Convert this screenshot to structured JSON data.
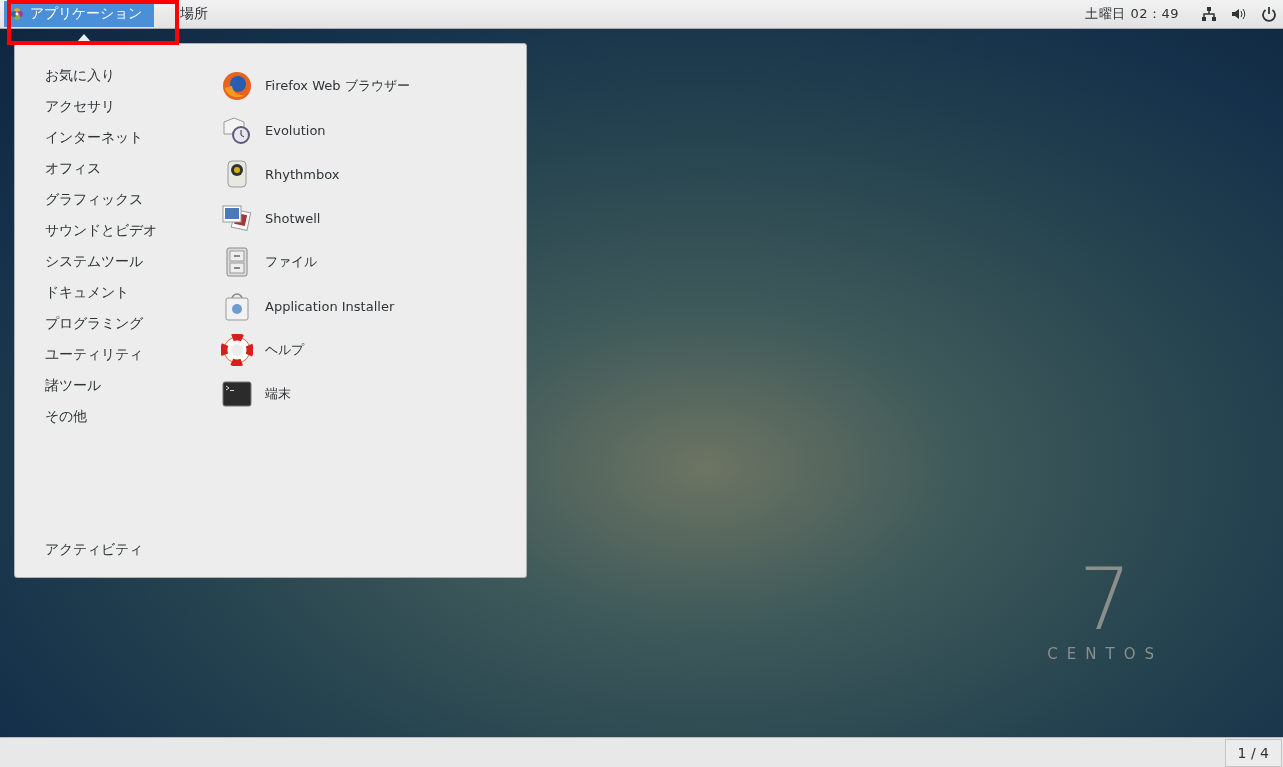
{
  "top_bar": {
    "menus": [
      {
        "label": "アプリケーション",
        "selected": true
      },
      {
        "label": "場所",
        "selected": false
      }
    ],
    "clock": "土曜日 02：49"
  },
  "applications_menu": {
    "categories": [
      {
        "label": "お気に入り"
      },
      {
        "label": "アクセサリ"
      },
      {
        "label": "インターネット"
      },
      {
        "label": "オフィス"
      },
      {
        "label": "グラフィックス"
      },
      {
        "label": "サウンドとビデオ"
      },
      {
        "label": "システムツール"
      },
      {
        "label": "ドキュメント"
      },
      {
        "label": "プログラミング"
      },
      {
        "label": "ユーティリティ"
      },
      {
        "label": "諸ツール"
      },
      {
        "label": "その他"
      }
    ],
    "activities": "アクティビティ",
    "apps": [
      {
        "kind": "firefox",
        "label": "Firefox Web ブラウザー"
      },
      {
        "kind": "evolution",
        "label": "Evolution"
      },
      {
        "kind": "rhythmbox",
        "label": "Rhythmbox"
      },
      {
        "kind": "shotwell",
        "label": "Shotwell"
      },
      {
        "kind": "files",
        "label": "ファイル"
      },
      {
        "kind": "installer",
        "label": "Application Installer"
      },
      {
        "kind": "help",
        "label": "ヘルプ"
      },
      {
        "kind": "terminal",
        "label": "端末"
      }
    ]
  },
  "wallpaper_logo": {
    "number": "7",
    "name": "CENTOS"
  },
  "bottom_bar": {
    "workspace": "1 / 4"
  }
}
